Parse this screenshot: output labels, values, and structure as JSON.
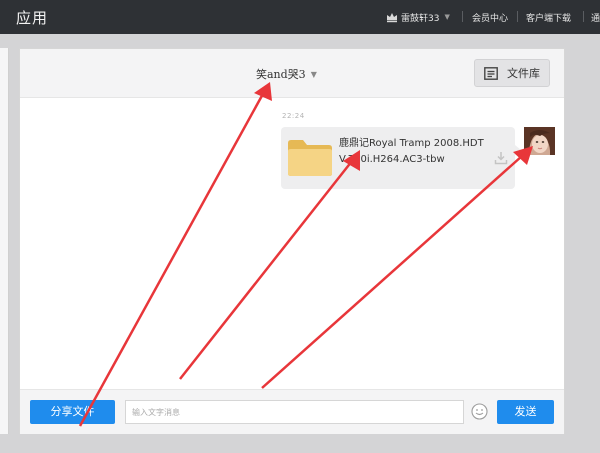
{
  "topbar": {
    "title": "应用",
    "user_name": "雷鼓轩33",
    "links": [
      "会员中心",
      "客户端下载",
      "通"
    ]
  },
  "chat": {
    "contact_name": "笑and哭3",
    "file_library_label": "文件库",
    "timestamp": "22:24",
    "message": {
      "file_name": "鹿鼎记Royal Tramp 2008.HDTV.720i.H264.AC3-tbw"
    }
  },
  "composer": {
    "share_label": "分享文件",
    "input_placeholder": "输入文字消息",
    "send_label": "发送"
  },
  "colors": {
    "topbar_bg": "#2e3135",
    "accent_blue": "#1f8ced",
    "annotation_red": "#e8363a",
    "folder_yellow": "#f2cf7a"
  },
  "icons": [
    "crown-icon",
    "file-library-icon",
    "folder-icon",
    "download-icon",
    "emoji-icon",
    "avatar"
  ]
}
